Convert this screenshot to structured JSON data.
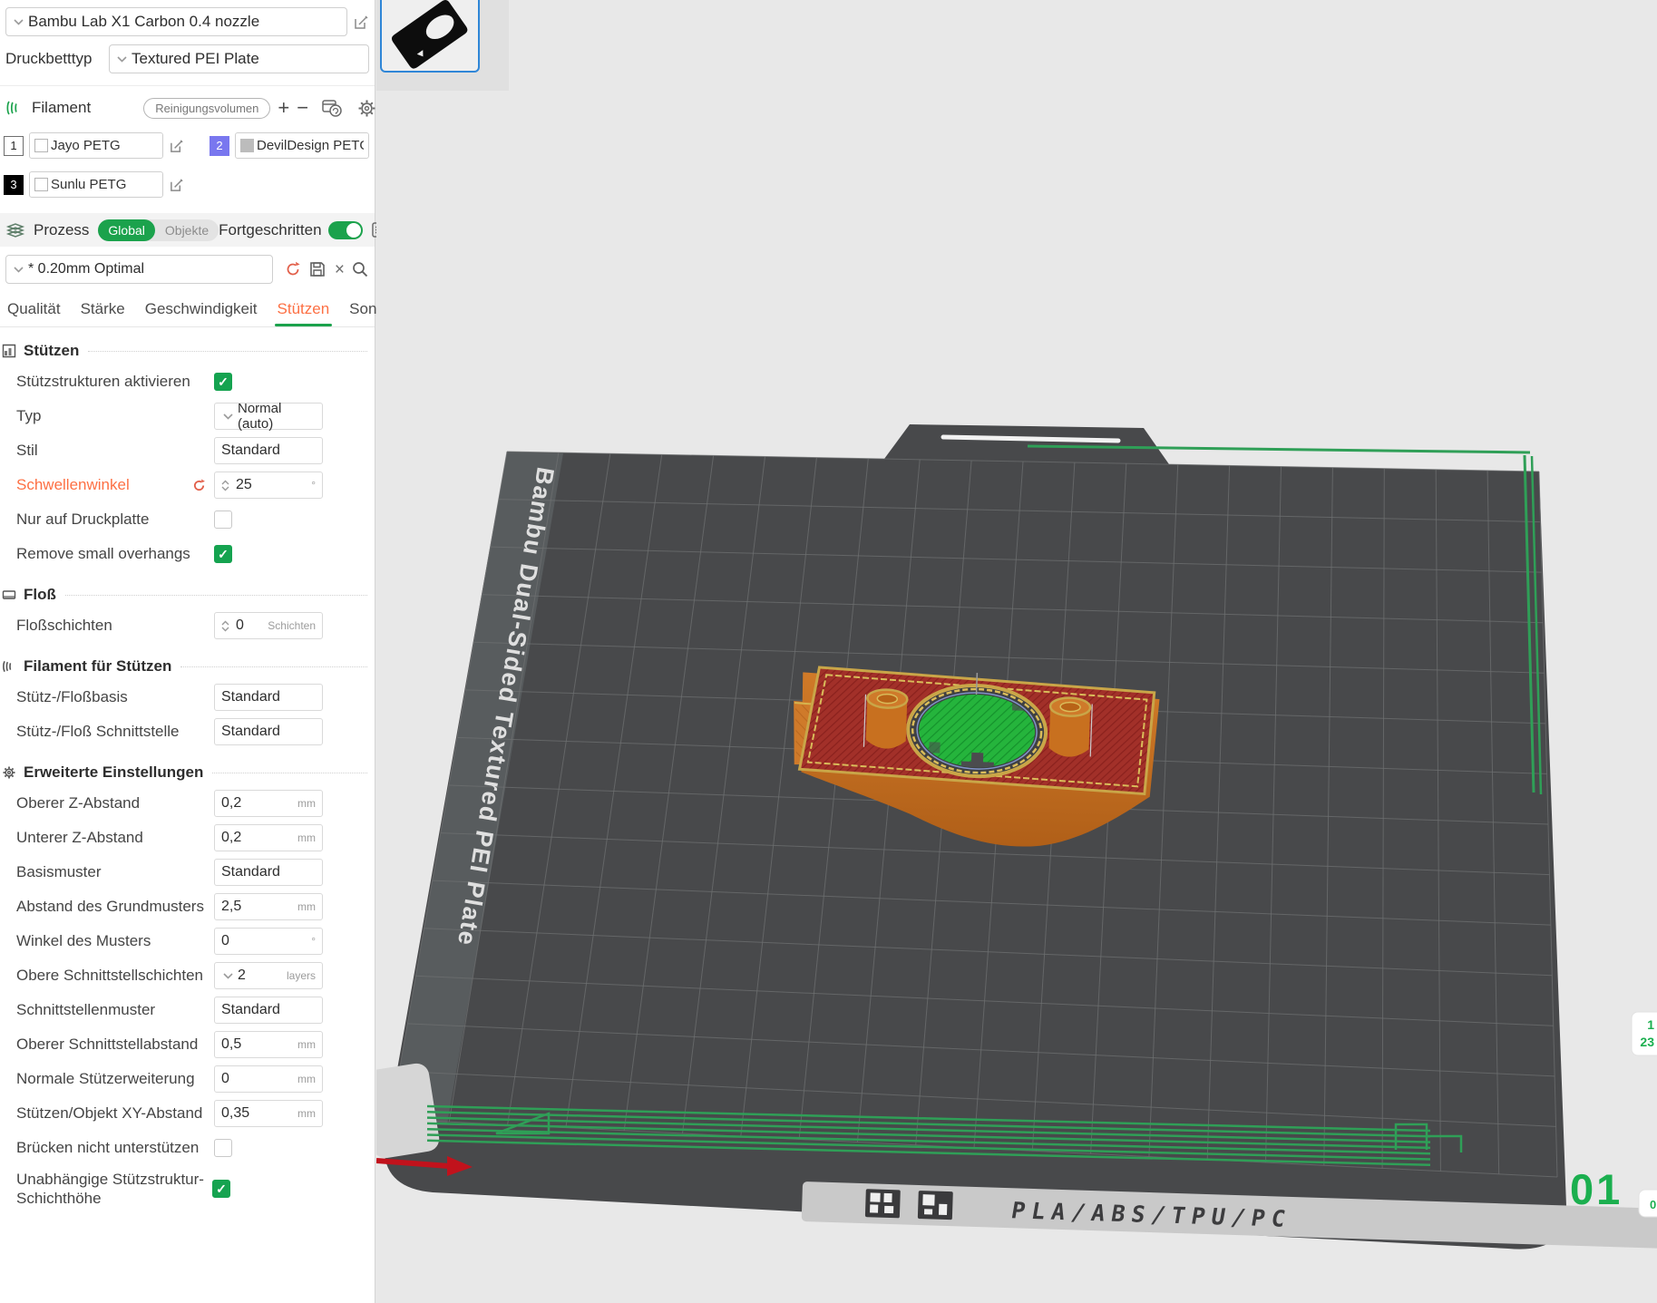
{
  "printer": {
    "name": "Bambu Lab X1 Carbon 0.4 nozzle"
  },
  "bed": {
    "label": "Druckbetttyp",
    "value": "Textured PEI Plate"
  },
  "filament": {
    "title": "Filament",
    "cleaning_volumes_button": "Reinigungsvolumen",
    "add_button": "+",
    "remove_button": "−",
    "slots": [
      {
        "number": "1",
        "name": "Jayo PETG",
        "badge_bg": "#ffffff",
        "badge_fg": "#262626",
        "swatch": "#ffffff"
      },
      {
        "number": "2",
        "name": "DevilDesign PETG",
        "badge_bg": "#7977ef",
        "badge_fg": "#ffffff",
        "swatch": "#bcbcbc"
      },
      {
        "number": "3",
        "name": "Sunlu PETG",
        "badge_bg": "#000000",
        "badge_fg": "#ffffff",
        "swatch": "#ffffff"
      }
    ]
  },
  "process": {
    "title": "Prozess",
    "scope_global": "Global",
    "scope_objects": "Objekte",
    "advanced_label": "Fortgeschritten",
    "advanced_on": true,
    "preset": "* 0.20mm Optimal",
    "close_glyph": "×"
  },
  "tabs": [
    {
      "label": "Qualität",
      "active": false
    },
    {
      "label": "Stärke",
      "active": false
    },
    {
      "label": "Geschwindigkeit",
      "active": false
    },
    {
      "label": "Stützen",
      "active": true
    },
    {
      "label": "Sonstige",
      "active": false
    }
  ],
  "support": {
    "title": "Stützen",
    "rows": [
      {
        "label": "Stützstrukturen aktivieren",
        "type": "checkbox",
        "checked": true
      },
      {
        "label": "Typ",
        "value": "Normal (auto)",
        "type": "select"
      },
      {
        "label": "Stil",
        "value": "Standard",
        "type": "input"
      },
      {
        "label": "Schwellenwinkel",
        "value": "25",
        "unit": "°",
        "type": "spinner",
        "modified": true
      },
      {
        "label": "Nur auf Druckplatte",
        "type": "checkbox",
        "checked": false
      },
      {
        "label": "Remove small overhangs",
        "type": "checkbox",
        "checked": true
      }
    ]
  },
  "raft": {
    "title": "Floß",
    "rows": [
      {
        "label": "Floßschichten",
        "value": "0",
        "unit": "Schichten",
        "type": "spinner"
      }
    ]
  },
  "support_filament": {
    "title": "Filament für Stützen",
    "rows": [
      {
        "label": "Stütz-/Floßbasis",
        "value": "Standard",
        "type": "input"
      },
      {
        "label": "Stütz-/Floß Schnittstelle",
        "value": "Standard",
        "type": "input"
      }
    ]
  },
  "advanced": {
    "title": "Erweiterte Einstellungen",
    "rows": [
      {
        "label": "Oberer Z-Abstand",
        "value": "0,2",
        "unit": "mm",
        "type": "input"
      },
      {
        "label": "Unterer Z-Abstand",
        "value": "0,2",
        "unit": "mm",
        "type": "input"
      },
      {
        "label": "Basismuster",
        "value": "Standard",
        "type": "input"
      },
      {
        "label": "Abstand des Grundmusters",
        "value": "2,5",
        "unit": "mm",
        "type": "input"
      },
      {
        "label": "Winkel des Musters",
        "value": "0",
        "unit": "°",
        "type": "input"
      },
      {
        "label": "Obere Schnittstellschichten",
        "value": "2",
        "unit": "layers",
        "type": "select"
      },
      {
        "label": "Schnittstellenmuster",
        "value": "Standard",
        "type": "input"
      },
      {
        "label": "Oberer Schnittstellabstand",
        "value": "0,5",
        "unit": "mm",
        "type": "input"
      },
      {
        "label": "Normale Stützerweiterung",
        "value": "0",
        "unit": "mm",
        "type": "input"
      },
      {
        "label": "Stützen/Objekt XY-Abstand",
        "value": "0,35",
        "unit": "mm",
        "type": "input"
      },
      {
        "label": "Brücken nicht unterstützen",
        "type": "checkbox",
        "checked": false
      },
      {
        "label": "Unabhängige Stützstruktur-Schichthöhe",
        "type": "checkbox",
        "checked": true
      }
    ]
  },
  "viewport": {
    "plate_brand_text": "Bambu Dual-Sided Textured PEI Plate",
    "plate_material_text": "PLA/ABS/TPU/PC",
    "plate_number": "01",
    "filament_chip_top_line1": "1",
    "filament_chip_top_line2": "23",
    "filament_chip_bottom": "0"
  },
  "colors": {
    "accent_green": "#1ba24c",
    "accent_orange": "#fd7044",
    "selection_blue": "#2f86d7",
    "plate_dark": "#48494b"
  }
}
